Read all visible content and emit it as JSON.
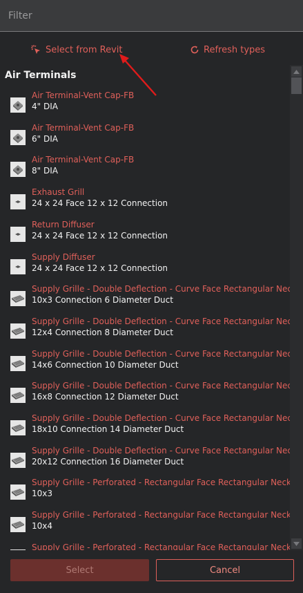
{
  "filter": {
    "placeholder": "Filter"
  },
  "toolbar": {
    "select_from_revit": "Select from Revit",
    "refresh_types": "Refresh types"
  },
  "colors": {
    "accent": "#e0605a",
    "background": "#252628",
    "text": "#f2f2f2"
  },
  "group": {
    "title": "Air Terminals"
  },
  "items": [
    {
      "name": "Air Terminal-Vent Cap-FB",
      "type": "4\" DIA",
      "icon": "vent-cap-icon"
    },
    {
      "name": "Air Terminal-Vent Cap-FB",
      "type": "6\" DIA",
      "icon": "vent-cap-icon"
    },
    {
      "name": "Air Terminal-Vent Cap-FB",
      "type": "8\" DIA",
      "icon": "vent-cap-icon"
    },
    {
      "name": "Exhaust Grill",
      "type": "24 x 24 Face 12 x 12 Connection",
      "icon": "diffuser-icon"
    },
    {
      "name": "Return Diffuser",
      "type": "24 x 24 Face 12 x 12 Connection",
      "icon": "diffuser-icon"
    },
    {
      "name": "Supply Diffuser",
      "type": "24 x 24 Face 12 x 12 Connection",
      "icon": "diffuser-icon"
    },
    {
      "name": "Supply Grille - Double Deflection - Curve Face Rectangular Neck",
      "type": "10x3 Connection 6 Diameter Duct",
      "icon": "grille-icon"
    },
    {
      "name": "Supply Grille - Double Deflection - Curve Face Rectangular Neck",
      "type": "12x4 Connection 8 Diameter Duct",
      "icon": "grille-icon"
    },
    {
      "name": "Supply Grille - Double Deflection - Curve Face Rectangular Neck",
      "type": "14x6 Connection 10 Diameter Duct",
      "icon": "grille-icon"
    },
    {
      "name": "Supply Grille - Double Deflection - Curve Face Rectangular Neck",
      "type": "16x8 Connection 12 Diameter Duct",
      "icon": "grille-icon"
    },
    {
      "name": "Supply Grille - Double Deflection - Curve Face Rectangular Neck",
      "type": "18x10 Connection 14 Diameter Duct",
      "icon": "grille-icon"
    },
    {
      "name": "Supply Grille - Double Deflection - Curve Face Rectangular Neck",
      "type": "20x12 Connection 16 Diameter Duct",
      "icon": "grille-icon"
    },
    {
      "name": "Supply Grille - Perforated - Rectangular Face Rectangular Neck",
      "type": "10x3",
      "icon": "grille-icon"
    },
    {
      "name": "Supply Grille - Perforated - Rectangular Face Rectangular Neck",
      "type": "10x4",
      "icon": "grille-icon"
    },
    {
      "name": "Supply Grille - Perforated - Rectangular Face Rectangular Neck",
      "type": "",
      "icon": "grille-icon"
    }
  ],
  "footer": {
    "select": "Select",
    "cancel": "Cancel"
  }
}
